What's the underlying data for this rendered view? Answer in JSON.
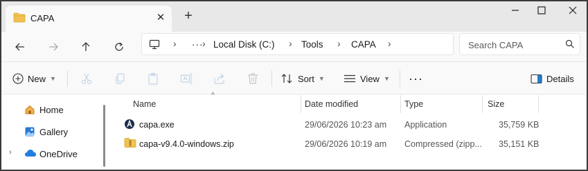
{
  "window": {
    "tab_title": "CAPA",
    "new_tab_glyph": "+",
    "close_tab_glyph": "✕",
    "controls": {
      "minimize": "—",
      "maximize": "☐",
      "close": "✕"
    }
  },
  "address_bar": {
    "overflow": "···",
    "breadcrumbs": [
      "Local Disk (C:)",
      "Tools",
      "CAPA"
    ],
    "separator": "›"
  },
  "search": {
    "placeholder": "Search CAPA"
  },
  "commands": {
    "new_label": "New",
    "sort_label": "Sort",
    "view_label": "View",
    "more_label": "···",
    "details_label": "Details",
    "icons": [
      "cut-icon",
      "copy-icon",
      "paste-icon",
      "rename-icon",
      "share-icon",
      "delete-icon"
    ]
  },
  "sidebar": {
    "items": [
      {
        "label": "Home",
        "icon": "home-icon"
      },
      {
        "label": "Gallery",
        "icon": "gallery-icon"
      },
      {
        "label": "OneDrive",
        "icon": "cloud-icon",
        "expander": "›"
      }
    ]
  },
  "columns": {
    "name": "Name",
    "date": "Date modified",
    "type": "Type",
    "size": "Size",
    "sort_caret": "^"
  },
  "files": [
    {
      "name": "capa.exe",
      "date": "29/06/2026 10:23 am",
      "type": "Application",
      "size": "35,759 KB",
      "icon": "app-icon"
    },
    {
      "name": "capa-v9.4.0-windows.zip",
      "date": "29/06/2026 10:19 am",
      "type": "Compressed (zipp...",
      "size": "35,151 KB",
      "icon": "zip-folder-icon"
    }
  ],
  "colors": {
    "accent": "#0067c0",
    "folder": "#f2c250"
  }
}
